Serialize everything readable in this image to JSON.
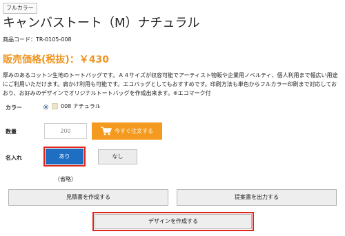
{
  "badge": "フルカラー",
  "product": {
    "title": "キャンバストート（M）ナチュラル",
    "code_label": "商品コード：",
    "code": "TR-0105-008",
    "price_label": "販売価格(税抜)：",
    "price": "￥430",
    "description": "厚みのあるコットン生地のトートバッグです。Ａ４サイズが収容可能でアーティスト物販や企業用ノベルティ、個人利用まで幅広い用途にご利用いただけます。肩かけ利用も可能です。エコバッグとしてもおすすめです。印刷方法も単色からフルカラー印刷まで対応しておおり、お好みのデザインでオリジナルトートバッグを作成出来ます。※エコマーク付"
  },
  "color": {
    "label": "カラー",
    "option": "008 ナチュラル",
    "swatch": "#efe5cc"
  },
  "quantity": {
    "label": "数量",
    "value": "200",
    "order_button": "今すぐ注文する"
  },
  "naire": {
    "label": "名入れ",
    "yes": "あり",
    "no": "なし",
    "note": "（省略）"
  },
  "actions": {
    "estimate": "見積書を作成する",
    "proposal": "提案書を出力する",
    "design": "デザインを作成する"
  },
  "colors": {
    "accent": "#f39a1f",
    "primary": "#1e6fc3",
    "highlight": "#e1251b"
  },
  "icons": {
    "cart": "cart-icon"
  }
}
